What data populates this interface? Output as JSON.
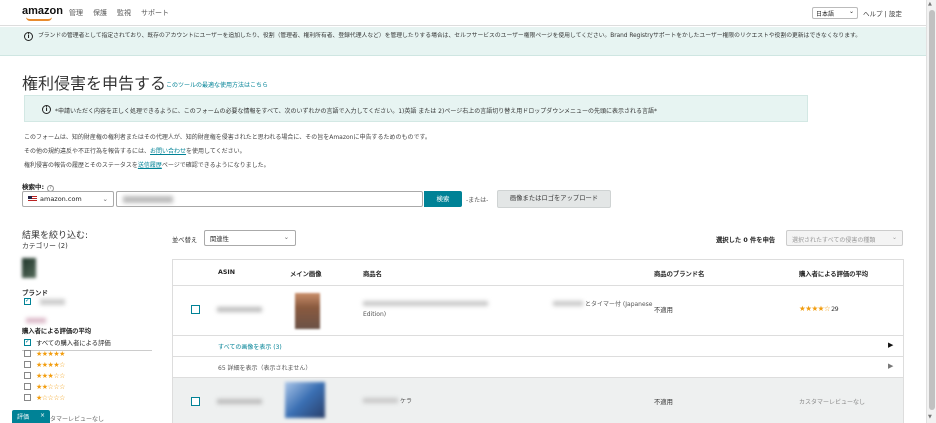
{
  "header": {
    "logo": "amazon",
    "nav": [
      "管理",
      "保護",
      "監視",
      "サポート"
    ],
    "language": "日本語",
    "help": "ヘルプ | 設定"
  },
  "banner": {
    "text": "ブランドの管理者として指定されており、既存のアカウントにユーザーを追加したり、役割（管理者、権利所有者、登録代理人など）を管理したりする場合は、セルフサービスのユーザー権限ページを使用してください。Brand Registryサポートをかしたユーザー権限のリクエストや役割の更新はできなくなります。"
  },
  "page": {
    "title": "権利侵害を申告する",
    "title_link": "このツールの最適な使用方法はこちら"
  },
  "notice": {
    "text": "*申請いただく内容を正しく処理できるように、このフォームの必要な情報をすべて、次のいずれかの言語で入力してください。1)英語 または 2)ページ右上の言語切り替え用ドロップダウンメニューの先頭に表示される言語*"
  },
  "description": {
    "line1": "このフォームは、知的財産権の権利者またはその代理人が、知的財産権を侵害されたと思われる場合に、その旨をAmazonに申告するためのものです。",
    "line2_prefix": "その他の規約違反や不正行為を報告するには、",
    "line2_link": "お問い合わせ",
    "line2_suffix": "を使用してください。",
    "line3_prefix": "権利侵害の報告の履歴とそのステータスを",
    "line3_link": "送信履歴",
    "line3_suffix": "ページで確認できるようになりました。"
  },
  "search": {
    "label": "検索中:",
    "help_icon": "?",
    "store": "amazon.com",
    "button": "検索",
    "or": "-または-",
    "upload_button": "画像またはロゴをアップロード"
  },
  "filters": {
    "title": "結果を絞り込む:",
    "category": "カテゴリー (2)",
    "brand": "ブランド",
    "rating_title": "購入者による評価の平均",
    "rating_options": [
      {
        "label": "すべての購入者による評価",
        "checked": true,
        "stars": ""
      },
      {
        "label": "",
        "checked": false,
        "stars": "★★★★★"
      },
      {
        "label": "",
        "checked": false,
        "stars": "★★★★☆"
      },
      {
        "label": "",
        "checked": false,
        "stars": "★★★☆☆"
      },
      {
        "label": "",
        "checked": false,
        "stars": "★★☆☆☆"
      },
      {
        "label": "",
        "checked": false,
        "stars": "★☆☆☆☆"
      }
    ],
    "no_review": "カスタマーレビューなし"
  },
  "results": {
    "sort_label": "並べ替え",
    "sort_value": "関連性",
    "selected_prefix": "選択した",
    "selected_count": "0",
    "selected_suffix": "件を申告",
    "report_select": "選択されたすべての侵害の種類"
  },
  "table": {
    "headers": [
      "ASIN",
      "メイン画像",
      "商品名",
      "商品のブランド名",
      "購入者による評価の平均"
    ],
    "row1": {
      "name_suffix": "とタイマー付 (Japanese",
      "name_line2": "Edition)",
      "brand": "不適用",
      "stars": "★★★★☆",
      "rating_count": "29",
      "link": "すべての画像を表示 (3)",
      "sub_text": "65 詳細を表示（表示されません）"
    },
    "row2": {
      "name_suffix": "ケラ",
      "brand": "不適用",
      "rating": "カスタマーレビューなし"
    }
  },
  "feedback": {
    "label": "評価",
    "close": "×"
  },
  "colors": {
    "accent": "#008296",
    "banner_bg": "#e7f4f2",
    "star": "#f29d0f"
  }
}
